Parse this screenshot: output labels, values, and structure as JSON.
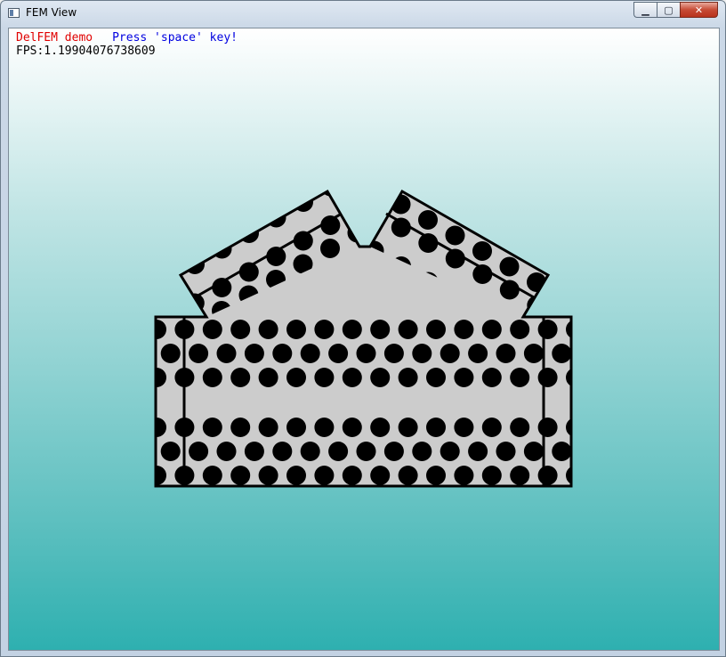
{
  "window": {
    "title": "FEM View",
    "minimize_glyph": "▁",
    "maximize_glyph": "▢",
    "close_glyph": "✕",
    "app_icon": "window-app-icon"
  },
  "hud": {
    "demo_label": "DelFEM demo",
    "instruction": "Press 'space' key!",
    "fps_text": "FPS:1.19904076738609"
  },
  "colors": {
    "demo_label": "#e00000",
    "instruction": "#0000e0",
    "body_fill": "#cccccc",
    "hole_fill": "#000000",
    "background_top": "#ffffff",
    "background_bottom": "#2eb0b0"
  }
}
